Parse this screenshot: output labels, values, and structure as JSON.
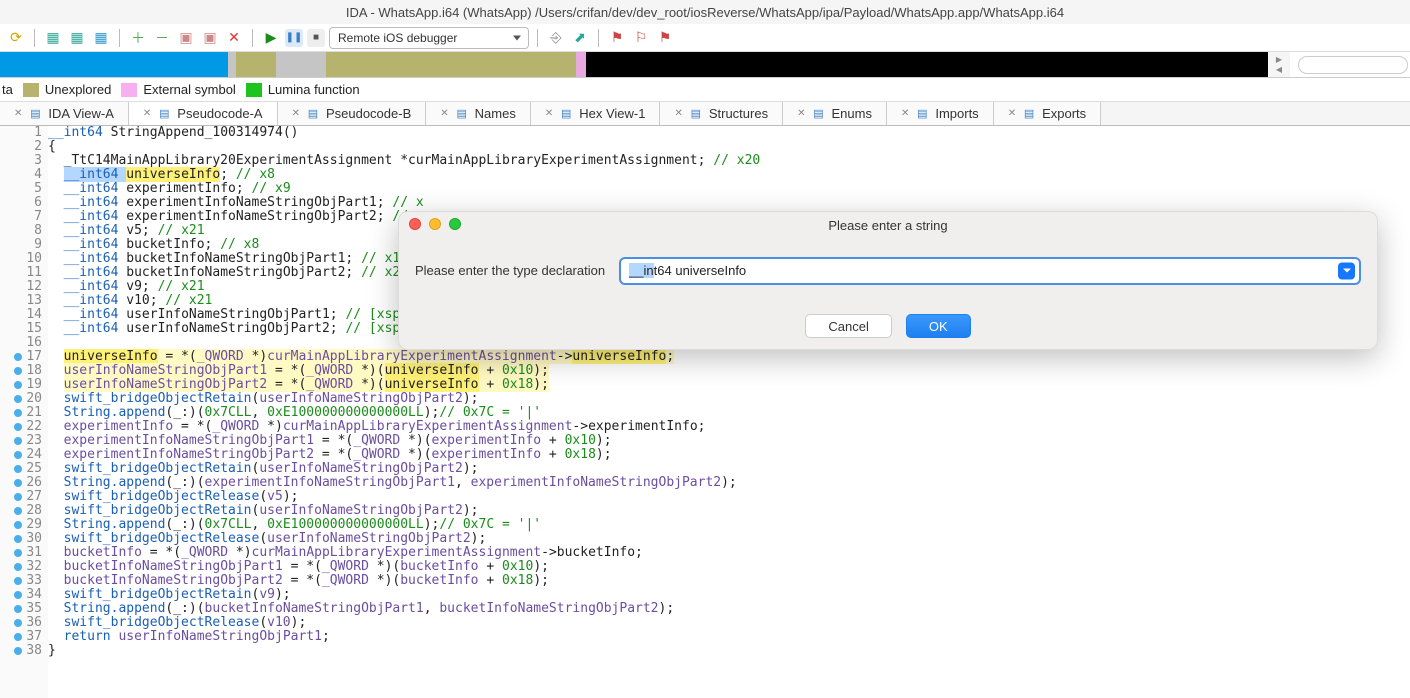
{
  "window_title": "IDA - WhatsApp.i64 (WhatsApp) /Users/crifan/dev/dev_root/iosReverse/WhatsApp/ipa/Payload/WhatsApp.app/WhatsApp.i64",
  "debugger_selected": "Remote iOS debugger",
  "legend": {
    "truncated": "ta",
    "unexplored": "Unexplored",
    "external": "External symbol",
    "lumina": "Lumina function"
  },
  "tabs": [
    "IDA View-A",
    "Pseudocode-A",
    "Pseudocode-B",
    "Names",
    "Hex View-1",
    "Structures",
    "Enums",
    "Imports",
    "Exports"
  ],
  "dialog": {
    "title": "Please enter a string",
    "label": "Please enter the type declaration",
    "value_prefix_sel": "__in",
    "value_rest": "t64 universeInfo",
    "cancel": "Cancel",
    "ok": "OK"
  },
  "code": {
    "lines": [
      {
        "n": 1,
        "bp": false,
        "html": "<span class='kw'>__int64</span> StringAppend_100314974<span>()</span>"
      },
      {
        "n": 2,
        "bp": false,
        "html": "{"
      },
      {
        "n": 3,
        "bp": false,
        "html": "  _TtC14MainAppLibrary20ExperimentAssignment *curMainAppLibraryExperimentAssignment; <span class='cmnt'>// x20</span>"
      },
      {
        "n": 4,
        "bp": false,
        "html": "  <span class='sel'><span class='kw'>__int64</span> <span class='hl'>universeInfo</span></span>; <span class='cmnt'>// x8</span>"
      },
      {
        "n": 5,
        "bp": false,
        "html": "  <span class='kw'>__int64</span> experimentInfo; <span class='cmnt'>// x9</span>"
      },
      {
        "n": 6,
        "bp": false,
        "html": "  <span class='kw'>__int64</span> experimentInfoNameStringObjPart1; <span class='cmnt'>// x</span>"
      },
      {
        "n": 7,
        "bp": false,
        "html": "  <span class='kw'>__int64</span> experimentInfoNameStringObjPart2; <span class='cmnt'>// x</span>"
      },
      {
        "n": 8,
        "bp": false,
        "html": "  <span class='kw'>__int64</span> v5; <span class='cmnt'>// x21</span>"
      },
      {
        "n": 9,
        "bp": false,
        "html": "  <span class='kw'>__int64</span> bucketInfo; <span class='cmnt'>// x8</span>"
      },
      {
        "n": 10,
        "bp": false,
        "html": "  <span class='kw'>__int64</span> bucketInfoNameStringObjPart1; <span class='cmnt'>// x19</span>"
      },
      {
        "n": 11,
        "bp": false,
        "html": "  <span class='kw'>__int64</span> bucketInfoNameStringObjPart2; <span class='cmnt'>// x22</span>"
      },
      {
        "n": 12,
        "bp": false,
        "html": "  <span class='kw'>__int64</span> v9; <span class='cmnt'>// x21</span>"
      },
      {
        "n": 13,
        "bp": false,
        "html": "  <span class='kw'>__int64</span> v10; <span class='cmnt'>// x21</span>"
      },
      {
        "n": 14,
        "bp": false,
        "html": "  <span class='kw'>__int64</span> userInfoNameStringObjPart1; <span class='cmnt'>// [xsp+0h]</span>"
      },
      {
        "n": 15,
        "bp": false,
        "html": "  <span class='kw'>__int64</span> userInfoNameStringObjPart2; <span class='cmnt'>// [xsp+8h] [xbp-38h]</span>"
      },
      {
        "n": 16,
        "bp": false,
        "html": ""
      },
      {
        "n": 17,
        "bp": true,
        "html": "  <span class='hlrow'><span class='hl'>universeInfo</span> = *(<span class='var'>_QWORD</span> *)<span class='var'>curMainAppLibraryExperimentAssignment</span>-&gt;<span class='hl'>universeInfo</span>;</span>"
      },
      {
        "n": 18,
        "bp": true,
        "html": "  <span class='hlrow'><span class='var'>userInfoNameStringObjPart1</span> = *(<span class='var'>_QWORD</span> *)(<span class='hl'>universeInfo</span> + <span class='num'>0x10</span>);</span>"
      },
      {
        "n": 19,
        "bp": true,
        "html": "  <span class='hlrow'><span class='var'>userInfoNameStringObjPart2</span> = *(<span class='var'>_QWORD</span> *)(<span class='hl'>universeInfo</span> + <span class='num'>0x18</span>);</span>"
      },
      {
        "n": 20,
        "bp": true,
        "html": "  <span class='func'>swift_bridgeObjectRetain</span>(<span class='var'>userInfoNameStringObjPart2</span>);"
      },
      {
        "n": 21,
        "bp": true,
        "html": "  <span class='func'>String.append</span>(_:)(<span class='num'>0x7CLL</span>, <span class='num'>0xE100000000000000LL</span>);<span class='cmnt'>// 0x7C = '|'</span>"
      },
      {
        "n": 22,
        "bp": true,
        "html": "  <span class='var'>experimentInfo</span> = *(<span class='var'>_QWORD</span> *)<span class='var'>curMainAppLibraryExperimentAssignment</span>-&gt;experimentInfo;"
      },
      {
        "n": 23,
        "bp": true,
        "html": "  <span class='var'>experimentInfoNameStringObjPart1</span> = *(<span class='var'>_QWORD</span> *)(<span class='var'>experimentInfo</span> + <span class='num'>0x10</span>);"
      },
      {
        "n": 24,
        "bp": true,
        "html": "  <span class='var'>experimentInfoNameStringObjPart2</span> = *(<span class='var'>_QWORD</span> *)(<span class='var'>experimentInfo</span> + <span class='num'>0x18</span>);"
      },
      {
        "n": 25,
        "bp": true,
        "html": "  <span class='func'>swift_bridgeObjectRetain</span>(<span class='var'>userInfoNameStringObjPart2</span>);"
      },
      {
        "n": 26,
        "bp": true,
        "html": "  <span class='func'>String.append</span>(_:)(<span class='var'>experimentInfoNameStringObjPart1</span>, <span class='var'>experimentInfoNameStringObjPart2</span>);"
      },
      {
        "n": 27,
        "bp": true,
        "html": "  <span class='func'>swift_bridgeObjectRelease</span>(<span class='var'>v5</span>);"
      },
      {
        "n": 28,
        "bp": true,
        "html": "  <span class='func'>swift_bridgeObjectRetain</span>(<span class='var'>userInfoNameStringObjPart2</span>);"
      },
      {
        "n": 29,
        "bp": true,
        "html": "  <span class='func'>String.append</span>(_:)(<span class='num'>0x7CLL</span>, <span class='num'>0xE100000000000000LL</span>);<span class='cmnt'>// 0x7C = '|'</span>"
      },
      {
        "n": 30,
        "bp": true,
        "html": "  <span class='func'>swift_bridgeObjectRelease</span>(<span class='var'>userInfoNameStringObjPart2</span>);"
      },
      {
        "n": 31,
        "bp": true,
        "html": "  <span class='var'>bucketInfo</span> = *(<span class='var'>_QWORD</span> *)<span class='var'>curMainAppLibraryExperimentAssignment</span>-&gt;bucketInfo;"
      },
      {
        "n": 32,
        "bp": true,
        "html": "  <span class='var'>bucketInfoNameStringObjPart1</span> = *(<span class='var'>_QWORD</span> *)(<span class='var'>bucketInfo</span> + <span class='num'>0x10</span>);"
      },
      {
        "n": 33,
        "bp": true,
        "html": "  <span class='var'>bucketInfoNameStringObjPart2</span> = *(<span class='var'>_QWORD</span> *)(<span class='var'>bucketInfo</span> + <span class='num'>0x18</span>);"
      },
      {
        "n": 34,
        "bp": true,
        "html": "  <span class='func'>swift_bridgeObjectRetain</span>(<span class='var'>v9</span>);"
      },
      {
        "n": 35,
        "bp": true,
        "html": "  <span class='func'>String.append</span>(_:)(<span class='var'>bucketInfoNameStringObjPart1</span>, <span class='var'>bucketInfoNameStringObjPart2</span>);"
      },
      {
        "n": 36,
        "bp": true,
        "html": "  <span class='func'>swift_bridgeObjectRelease</span>(<span class='var'>v10</span>);"
      },
      {
        "n": 37,
        "bp": true,
        "html": "  <span class='kw'>return</span> <span class='var'>userInfoNameStringObjPart1</span>;"
      },
      {
        "n": 38,
        "bp": true,
        "html": "}"
      }
    ]
  }
}
